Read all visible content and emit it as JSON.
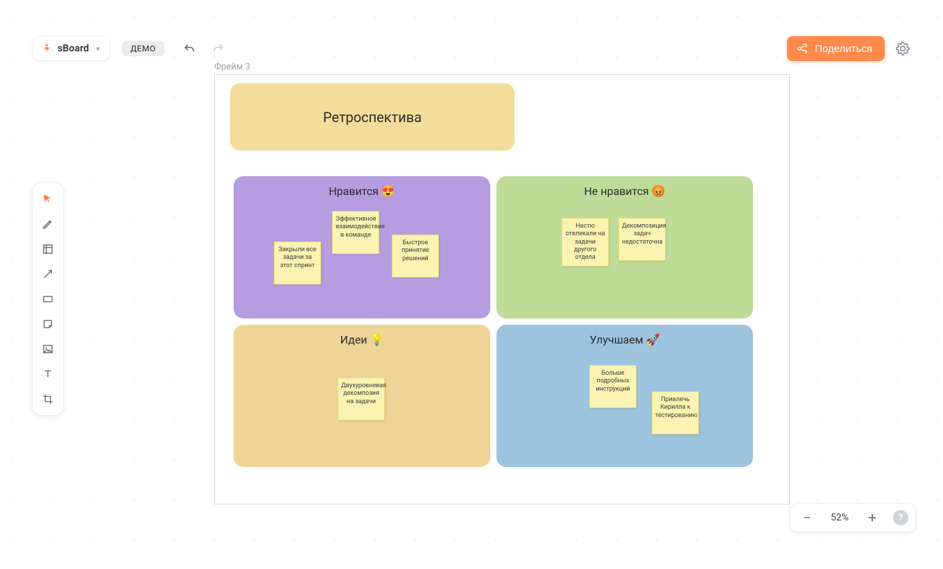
{
  "header": {
    "app_name": "sBoard",
    "demo_badge": "ДЕМО",
    "share_label": "Поделиться"
  },
  "frame": {
    "label": "Фрейм 3",
    "title_card": "Ретроспектива"
  },
  "quadrants": {
    "like": {
      "title": "Нравится 😍"
    },
    "dislike": {
      "title": "Не нравится 😡"
    },
    "ideas": {
      "title": "Идеи 💡"
    },
    "improve": {
      "title": "Улучшаем 🚀"
    }
  },
  "stickies": {
    "like_1": "Закрыли все задачи за этот спринт",
    "like_2": "Эффективное взаимодействие в команде",
    "like_3": "Быстрое принятие решений",
    "dislike_1": "Настю отвлекали на задачи другого отдела",
    "dislike_2": "Декомпозиция задач недостаточна",
    "ideas_1": "Двухуровневая декомпозия на задачи",
    "improve_1": "Больше подробных инструкций",
    "improve_2": "Привлечь Кирилла к тестированию"
  },
  "zoom": {
    "value": "52%"
  }
}
